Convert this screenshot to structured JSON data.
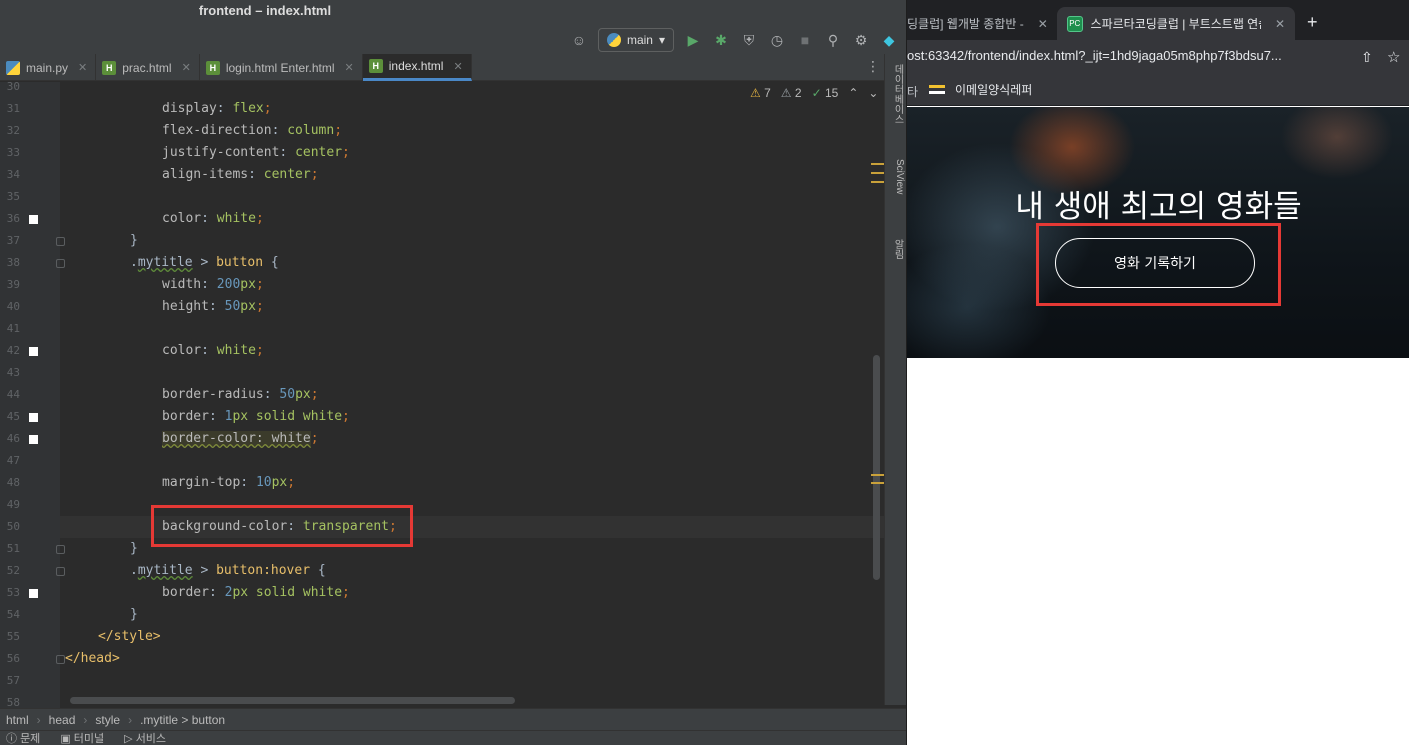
{
  "ide": {
    "window_title": "frontend – index.html",
    "branch": "main",
    "tabs": [
      {
        "label": "main.py",
        "type": "py",
        "active": false
      },
      {
        "label": "prac.html",
        "type": "html",
        "active": false
      },
      {
        "label": "login.html Enter.html",
        "type": "html",
        "active": false
      },
      {
        "label": "index.html",
        "type": "html",
        "active": true
      }
    ],
    "inspection": {
      "warnings": "7",
      "weak_warnings": "2",
      "typos": "15"
    },
    "right_strip": [
      "데이터베이스",
      "SciView",
      "알림"
    ],
    "lines": [
      {
        "n": "30",
        "segs": []
      },
      {
        "n": "31",
        "segs": [
          [
            "prop",
            "display"
          ],
          [
            "plain",
            ": "
          ],
          [
            "val",
            "flex"
          ],
          [
            "punc",
            ";"
          ]
        ]
      },
      {
        "n": "32",
        "segs": [
          [
            "prop",
            "flex-direction"
          ],
          [
            "plain",
            ": "
          ],
          [
            "val",
            "column"
          ],
          [
            "punc",
            ";"
          ]
        ]
      },
      {
        "n": "33",
        "segs": [
          [
            "prop",
            "justify-content"
          ],
          [
            "plain",
            ": "
          ],
          [
            "val",
            "center"
          ],
          [
            "punc",
            ";"
          ]
        ]
      },
      {
        "n": "34",
        "segs": [
          [
            "prop",
            "align-items"
          ],
          [
            "plain",
            ": "
          ],
          [
            "val",
            "center"
          ],
          [
            "punc",
            ";"
          ]
        ]
      },
      {
        "n": "35",
        "segs": []
      },
      {
        "n": "36",
        "segs": [
          [
            "prop",
            "color"
          ],
          [
            "plain",
            ": "
          ],
          [
            "val",
            "white"
          ],
          [
            "punc",
            ";"
          ]
        ],
        "mark": true
      },
      {
        "n": "37",
        "segs": [
          [
            "plain",
            "}"
          ]
        ],
        "fold": true
      },
      {
        "n": "38",
        "segs": [
          [
            "plain",
            "."
          ],
          [
            "cls",
            "mytitle"
          ],
          [
            "plain",
            " > "
          ],
          [
            "sel",
            "button"
          ],
          [
            "plain",
            " {"
          ]
        ],
        "fold": true
      },
      {
        "n": "39",
        "segs": [
          [
            "prop",
            "width"
          ],
          [
            "plain",
            ": "
          ],
          [
            "num",
            "200"
          ],
          [
            "val",
            "px"
          ],
          [
            "punc",
            ";"
          ]
        ]
      },
      {
        "n": "40",
        "segs": [
          [
            "prop",
            "height"
          ],
          [
            "plain",
            ": "
          ],
          [
            "num",
            "50"
          ],
          [
            "val",
            "px"
          ],
          [
            "punc",
            ";"
          ]
        ]
      },
      {
        "n": "41",
        "segs": []
      },
      {
        "n": "42",
        "segs": [
          [
            "prop",
            "color"
          ],
          [
            "plain",
            ": "
          ],
          [
            "val",
            "white"
          ],
          [
            "punc",
            ";"
          ]
        ],
        "mark": true
      },
      {
        "n": "43",
        "segs": []
      },
      {
        "n": "44",
        "segs": [
          [
            "prop",
            "border-radius"
          ],
          [
            "plain",
            ": "
          ],
          [
            "num",
            "50"
          ],
          [
            "val",
            "px"
          ],
          [
            "punc",
            ";"
          ]
        ]
      },
      {
        "n": "45",
        "segs": [
          [
            "prop",
            "border"
          ],
          [
            "plain",
            ": "
          ],
          [
            "num",
            "1"
          ],
          [
            "val",
            "px solid white"
          ],
          [
            "punc",
            ";"
          ]
        ],
        "mark": true
      },
      {
        "n": "46",
        "segs": [
          [
            "warn",
            "border-color: white"
          ],
          [
            "punc",
            ";"
          ]
        ],
        "mark": true
      },
      {
        "n": "47",
        "segs": []
      },
      {
        "n": "48",
        "segs": [
          [
            "prop",
            "margin-top"
          ],
          [
            "plain",
            ": "
          ],
          [
            "num",
            "10"
          ],
          [
            "val",
            "px"
          ],
          [
            "punc",
            ";"
          ]
        ]
      },
      {
        "n": "49",
        "segs": []
      },
      {
        "n": "50",
        "segs": [
          [
            "prop",
            "background-color"
          ],
          [
            "plain",
            ": "
          ],
          [
            "val",
            "transparent"
          ],
          [
            "punc",
            ";"
          ]
        ],
        "current": true
      },
      {
        "n": "51",
        "segs": [
          [
            "plain",
            "}"
          ]
        ],
        "fold": true
      },
      {
        "n": "52",
        "segs": [
          [
            "plain",
            "."
          ],
          [
            "cls",
            "mytitle"
          ],
          [
            "plain",
            " > "
          ],
          [
            "sel",
            "button:hover"
          ],
          [
            "plain",
            " {"
          ]
        ],
        "fold": true
      },
      {
        "n": "53",
        "segs": [
          [
            "prop",
            "border"
          ],
          [
            "plain",
            ": "
          ],
          [
            "num",
            "2"
          ],
          [
            "val",
            "px solid white"
          ],
          [
            "punc",
            ";"
          ]
        ],
        "mark": true
      },
      {
        "n": "54",
        "segs": [
          [
            "plain",
            "}"
          ]
        ]
      },
      {
        "n": "55",
        "segs": [
          [
            "tag",
            "</style>"
          ]
        ]
      },
      {
        "n": "56",
        "segs": [
          [
            "tag",
            "</head>"
          ]
        ],
        "fold": true
      },
      {
        "n": "57",
        "segs": []
      },
      {
        "n": "58",
        "segs": []
      }
    ],
    "breadcrumb": [
      "html",
      "head",
      "style",
      ".mytitle > button"
    ],
    "status": [
      "문제",
      "터미널",
      "서비스"
    ]
  },
  "browser": {
    "tabs": [
      {
        "label": "딩클럽] 웹개발 종합반 -",
        "active": false
      },
      {
        "label": "스파르타코딩클럽 | 부트스트랩 연습하",
        "active": true
      }
    ],
    "url": "ost:63342/frontend/index.html?_ijt=1hd9jaga05m8php7f3bdsu7...",
    "bookmark_fragment": "타",
    "bookmark": "이메일양식레퍼",
    "hero_title": "내 생애 최고의 영화들",
    "hero_button": "영화 기록하기"
  }
}
